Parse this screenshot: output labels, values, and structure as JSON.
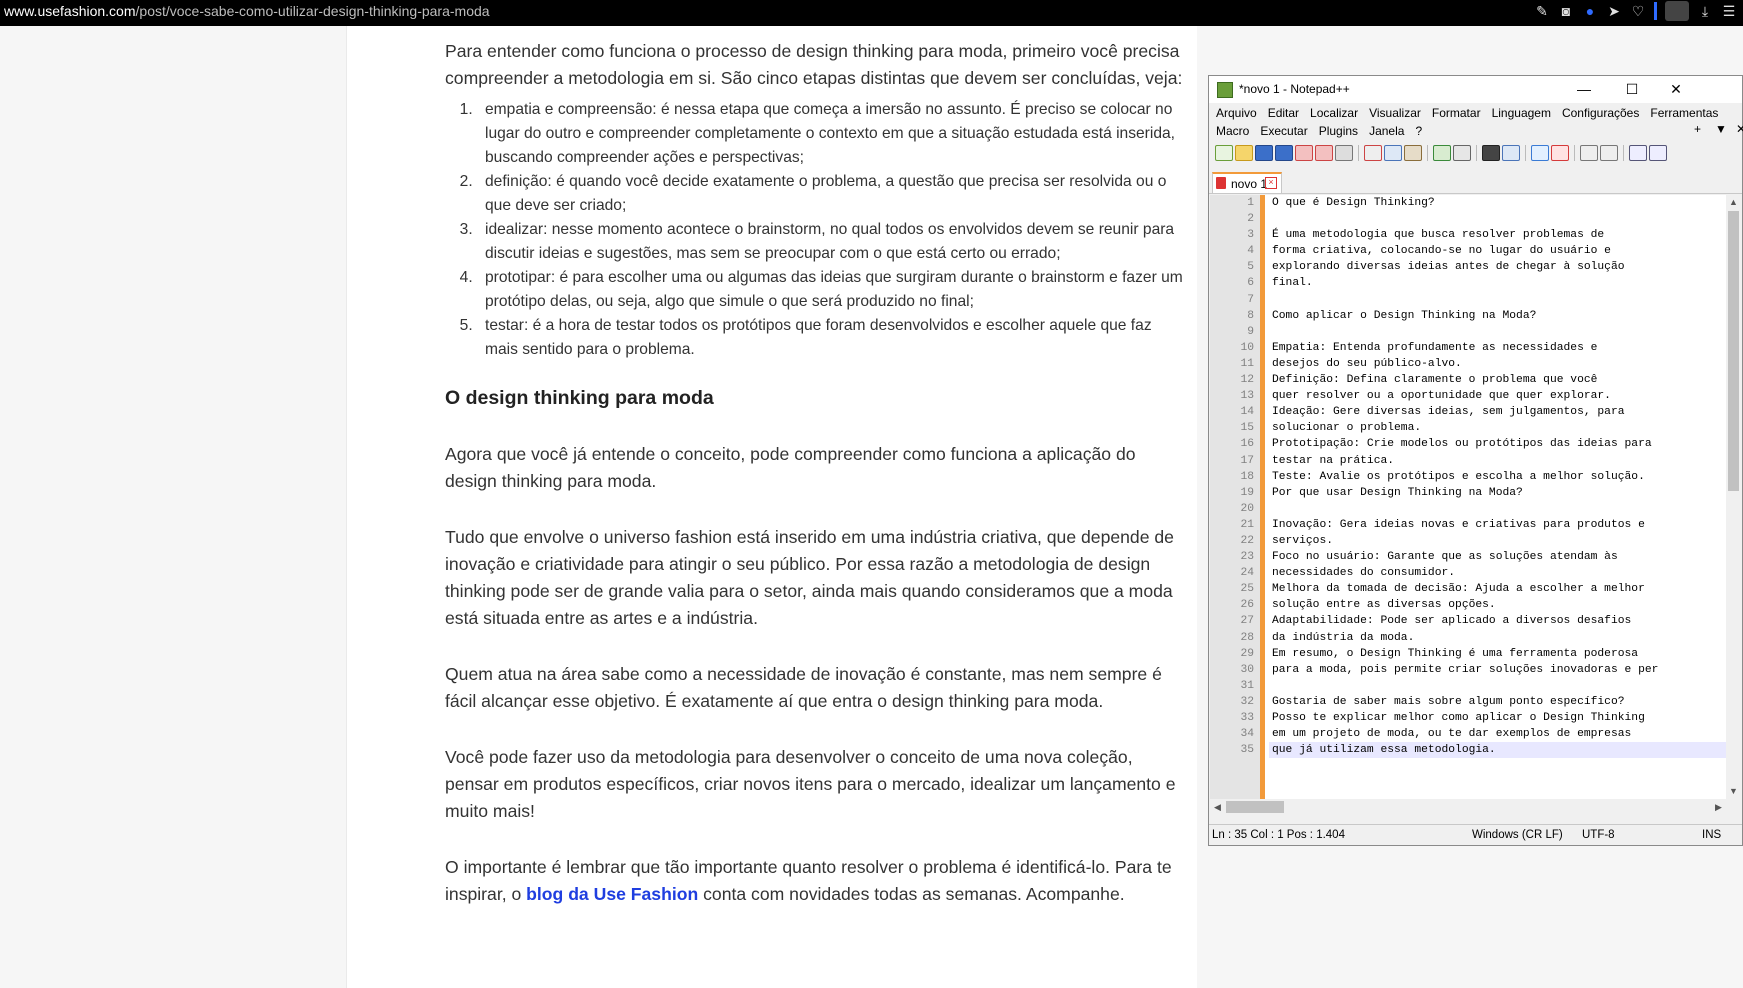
{
  "browser": {
    "url_domain": "www.usefashion.com",
    "url_path": "/post/voce-sabe-como-utilizar-design-thinking-para-moda"
  },
  "article": {
    "intro": "Para entender como funciona o processo de design thinking para moda, primeiro você precisa compreender a metodologia em si. São cinco etapas distintas que devem ser concluídas, veja:",
    "steps": [
      "empatia e compreensão: é nessa etapa que começa a imersão no assunto. É preciso se colocar no lugar do outro e compreender completamente o contexto em que a situação estudada está inserida, buscando compreender ações e perspectivas;",
      "definição: é quando você decide exatamente o problema, a questão que precisa ser resolvida ou o que deve ser criado;",
      "idealizar: nesse momento acontece o brainstorm, no qual todos os envolvidos devem se reunir para discutir ideias e sugestões, mas sem se preocupar com o que está certo ou errado;",
      "prototipar: é para escolher uma ou algumas das ideias que surgiram durante o brainstorm e fazer um protótipo delas, ou seja, algo que simule o que será produzido no final;",
      "testar: é a hora de testar todos os protótipos que foram desenvolvidos e escolher aquele que faz mais sentido para o problema."
    ],
    "heading": "O design thinking para moda",
    "p1": "Agora que você já entende o conceito, pode compreender como funciona a aplicação do design thinking para moda.",
    "p2": "Tudo que envolve o universo fashion está inserido em uma indústria criativa, que depende de inovação e criatividade para atingir o seu público. Por essa razão a metodologia de design thinking pode ser de grande valia para o setor, ainda mais quando consideramos que a moda está situada entre as artes e a indústria.",
    "p3": "Quem atua na área sabe como a necessidade de inovação é constante, mas nem sempre é fácil alcançar esse objetivo. É exatamente aí que entra o design thinking para moda.",
    "p4": "Você pode fazer uso da metodologia para desenvolver o conceito de uma nova coleção, pensar em produtos específicos, criar novos itens para o mercado, idealizar um lançamento e muito mais!",
    "p5_before": "O importante é lembrar que tão importante quanto resolver o problema é identificá-lo. Para te inspirar, o ",
    "p5_link": "blog da Use Fashion",
    "p5_after": " conta com novidades todas as semanas. Acompanhe."
  },
  "notepad": {
    "title": "*novo 1 - Notepad++",
    "menu_row1": [
      "Arquivo",
      "Editar",
      "Localizar",
      "Visualizar",
      "Formatar",
      "Linguagem",
      "Configurações",
      "Ferramentas"
    ],
    "menu_row2": [
      "Macro",
      "Executar",
      "Plugins",
      "Janela",
      "?"
    ],
    "menu_right": [
      "+",
      "▼",
      "✕"
    ],
    "tab_label": "novo 1",
    "lines": [
      "O que é Design Thinking?",
      "",
      "É uma metodologia que busca resolver problemas de",
      "forma criativa, colocando-se no lugar do usuário e",
      "explorando diversas ideias antes de chegar à solução",
      "final.",
      "",
      "Como aplicar o Design Thinking na Moda?",
      "",
      "Empatia: Entenda profundamente as necessidades e",
      "desejos do seu público-alvo.",
      "Definição: Defina claramente o problema que você",
      "quer resolver ou a oportunidade que quer explorar.",
      "Ideação: Gere diversas ideias, sem julgamentos, para",
      "solucionar o problema.",
      "Prototipação: Crie modelos ou protótipos das ideias para",
      "testar na prática.",
      "Teste: Avalie os protótipos e escolha a melhor solução.",
      "Por que usar Design Thinking na Moda?",
      "",
      "Inovação: Gera ideias novas e criativas para produtos e",
      "serviços.",
      "Foco no usuário: Garante que as soluções atendam às",
      "necessidades do consumidor.",
      "Melhora da tomada de decisão: Ajuda a escolher a melhor",
      "solução entre as diversas opções.",
      "Adaptabilidade: Pode ser aplicado a diversos desafios",
      "da indústria da moda.",
      "Em resumo, o Design Thinking é uma ferramenta poderosa",
      "para a moda, pois permite criar soluções inovadoras e per",
      "",
      "Gostaria de saber mais sobre algum ponto específico?",
      "Posso te explicar melhor como aplicar o Design Thinking",
      "em um projeto de moda, ou te dar exemplos de empresas",
      "que já utilizam essa metodologia."
    ],
    "status": {
      "position": "Ln : 35    Col : 1    Pos : 1.404",
      "eol": "Windows (CR LF)",
      "encoding": "UTF-8",
      "mode": "INS"
    }
  }
}
